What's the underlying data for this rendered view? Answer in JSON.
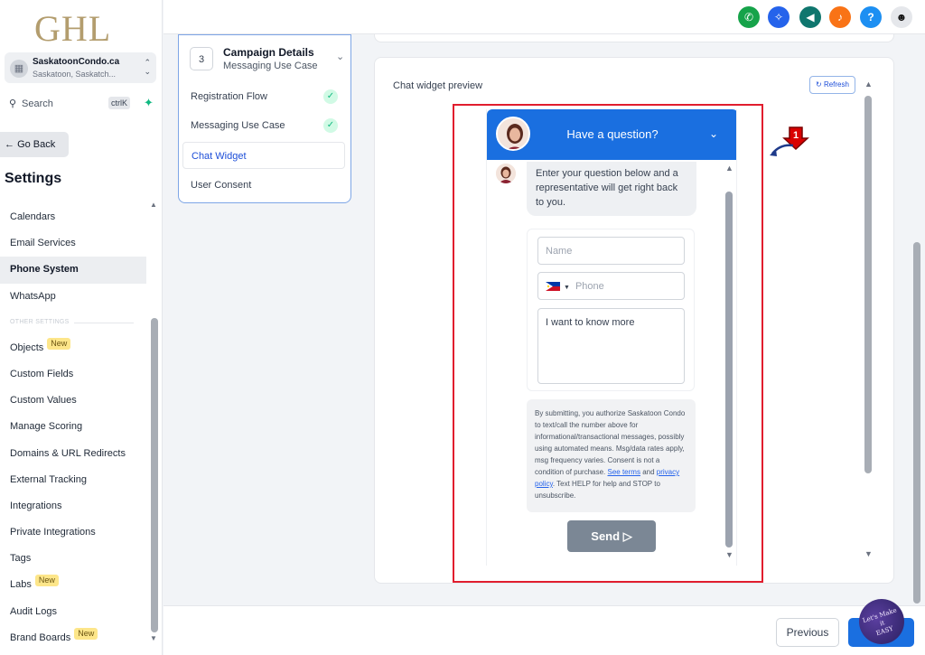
{
  "logo": "GHL",
  "account": {
    "name": "SaskatoonCondo.ca",
    "location": "Saskatoon, Saskatch..."
  },
  "search": {
    "label": "Search",
    "shortcut": "ctrlK"
  },
  "nav": {
    "go_back": "Go Back",
    "settings_title": "Settings",
    "items_top": [
      "Calendars",
      "Email Services",
      "Phone System",
      "WhatsApp"
    ],
    "active_item": "Phone System",
    "section_label": "OTHER SETTINGS",
    "items_bottom": [
      {
        "label": "Objects",
        "badge": "New"
      },
      {
        "label": "Custom Fields",
        "badge": ""
      },
      {
        "label": "Custom Values",
        "badge": ""
      },
      {
        "label": "Manage Scoring",
        "badge": ""
      },
      {
        "label": "Domains & URL Redirects",
        "badge": ""
      },
      {
        "label": "External Tracking",
        "badge": ""
      },
      {
        "label": "Integrations",
        "badge": ""
      },
      {
        "label": "Private Integrations",
        "badge": ""
      },
      {
        "label": "Tags",
        "badge": ""
      },
      {
        "label": "Labs",
        "badge": "New"
      },
      {
        "label": "Audit Logs",
        "badge": ""
      },
      {
        "label": "Brand Boards",
        "badge": "New"
      }
    ]
  },
  "topbar": {
    "icons": [
      {
        "name": "phone-icon",
        "color": "#16a34a",
        "glyph": "✆"
      },
      {
        "name": "sparkle-icon",
        "color": "#2563eb",
        "glyph": "✧"
      },
      {
        "name": "megaphone-icon",
        "color": "#0f766e",
        "glyph": "📢"
      },
      {
        "name": "bell-icon",
        "color": "#f97316",
        "glyph": "🔔"
      },
      {
        "name": "help-icon",
        "color": "#1d8ff2",
        "glyph": "?"
      }
    ]
  },
  "steps": {
    "number": "3",
    "title": "Campaign Details",
    "subtitle": "Messaging Use Case",
    "items": [
      {
        "label": "Registration Flow",
        "done": true
      },
      {
        "label": "Messaging Use Case",
        "done": true
      },
      {
        "label": "Chat Widget",
        "done": false
      },
      {
        "label": "User Consent",
        "done": false
      }
    ],
    "active": "Chat Widget"
  },
  "preview": {
    "title": "Chat widget preview",
    "refresh": "Refresh"
  },
  "callout_number": "1",
  "widget": {
    "header": "Have a question?",
    "message": "Enter your question below and a representative will get right back to you.",
    "name_placeholder": "Name",
    "phone_placeholder": "Phone",
    "message_value": "I want to know more",
    "consent_before_terms": "By submitting, you authorize Saskatoon Condo to text/call the number above for informational/transactional messages, possibly using automated means. Msg/data rates apply, msg frequency varies. Consent is not a condition of purchase. ",
    "see_terms": "See terms",
    "and": " and ",
    "privacy_policy": "privacy policy",
    "consent_after": ". Text HELP for help and STOP to unsubscribe.",
    "send": "Send",
    "header_color": "#1a6fe0"
  },
  "footer": {
    "previous": "Previous"
  },
  "stamp": {
    "line1": "Let's Make",
    "line2": "it",
    "line3": "EASY"
  }
}
